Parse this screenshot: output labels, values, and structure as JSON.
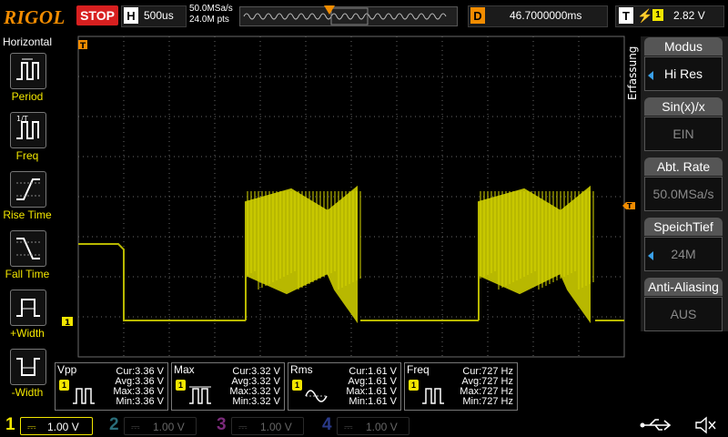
{
  "brand": "RIGOL",
  "run_state": "STOP",
  "horizontal": {
    "letter": "H",
    "timebase": "500us",
    "sample_rate": "50.0MSa/s",
    "points": "24.0M pts"
  },
  "delay": {
    "letter": "D",
    "value": "46.7000000ms"
  },
  "trigger": {
    "letter": "T",
    "edge": "⚡",
    "channel": "1",
    "level": "2.82 V"
  },
  "left_menu": {
    "title": "Horizontal",
    "items": [
      {
        "label": "Period"
      },
      {
        "label": "Freq"
      },
      {
        "label": "Rise Time"
      },
      {
        "label": "Fall Time"
      },
      {
        "label": "+Width"
      },
      {
        "label": "-Width"
      }
    ]
  },
  "right_menu": {
    "title": "Erfassung",
    "items": [
      {
        "label": "Modus",
        "value": "Hi Res"
      },
      {
        "label": "Sin(x)/x",
        "value": "EIN"
      },
      {
        "label": "Abt. Rate",
        "value": "50.0MSa/s"
      },
      {
        "label": "SpeichTief",
        "value": "24M"
      },
      {
        "label": "Anti-Aliasing",
        "value": "AUS"
      }
    ]
  },
  "markers": {
    "trigger_left": "T",
    "ch1_ground": "1",
    "trigger_right": "T"
  },
  "measurements": [
    {
      "name": "Vpp",
      "ch": "1",
      "cur": "Cur:3.36 V",
      "avg": "Avg:3.36 V",
      "max": "Max:3.36 V",
      "min": "Min:3.36 V"
    },
    {
      "name": "Max",
      "ch": "1",
      "cur": "Cur:3.32 V",
      "avg": "Avg:3.32 V",
      "max": "Max:3.32 V",
      "min": "Min:3.32 V"
    },
    {
      "name": "Rms",
      "ch": "1",
      "cur": "Cur:1.61 V",
      "avg": "Avg:1.61 V",
      "max": "Max:1.61 V",
      "min": "Min:1.61 V"
    },
    {
      "name": "Freq",
      "ch": "1",
      "cur": "Cur:727 Hz",
      "avg": "Avg:727 Hz",
      "max": "Max:727 Hz",
      "min": "Min:727 Hz"
    }
  ],
  "channels": [
    {
      "num": "1",
      "scale": "1.00 V",
      "active": true
    },
    {
      "num": "2",
      "scale": "1.00 V",
      "active": false
    },
    {
      "num": "3",
      "scale": "1.00 V",
      "active": false
    },
    {
      "num": "4",
      "scale": "1.00 V",
      "active": false
    }
  ],
  "colors": {
    "ch1": "#f2e600",
    "ch2": "#00c8ff",
    "ch3": "#ff00ff",
    "ch4": "#1e50ff",
    "brand": "#f28c00",
    "grid": "#6a6a6a",
    "trace": "#b8b800"
  }
}
